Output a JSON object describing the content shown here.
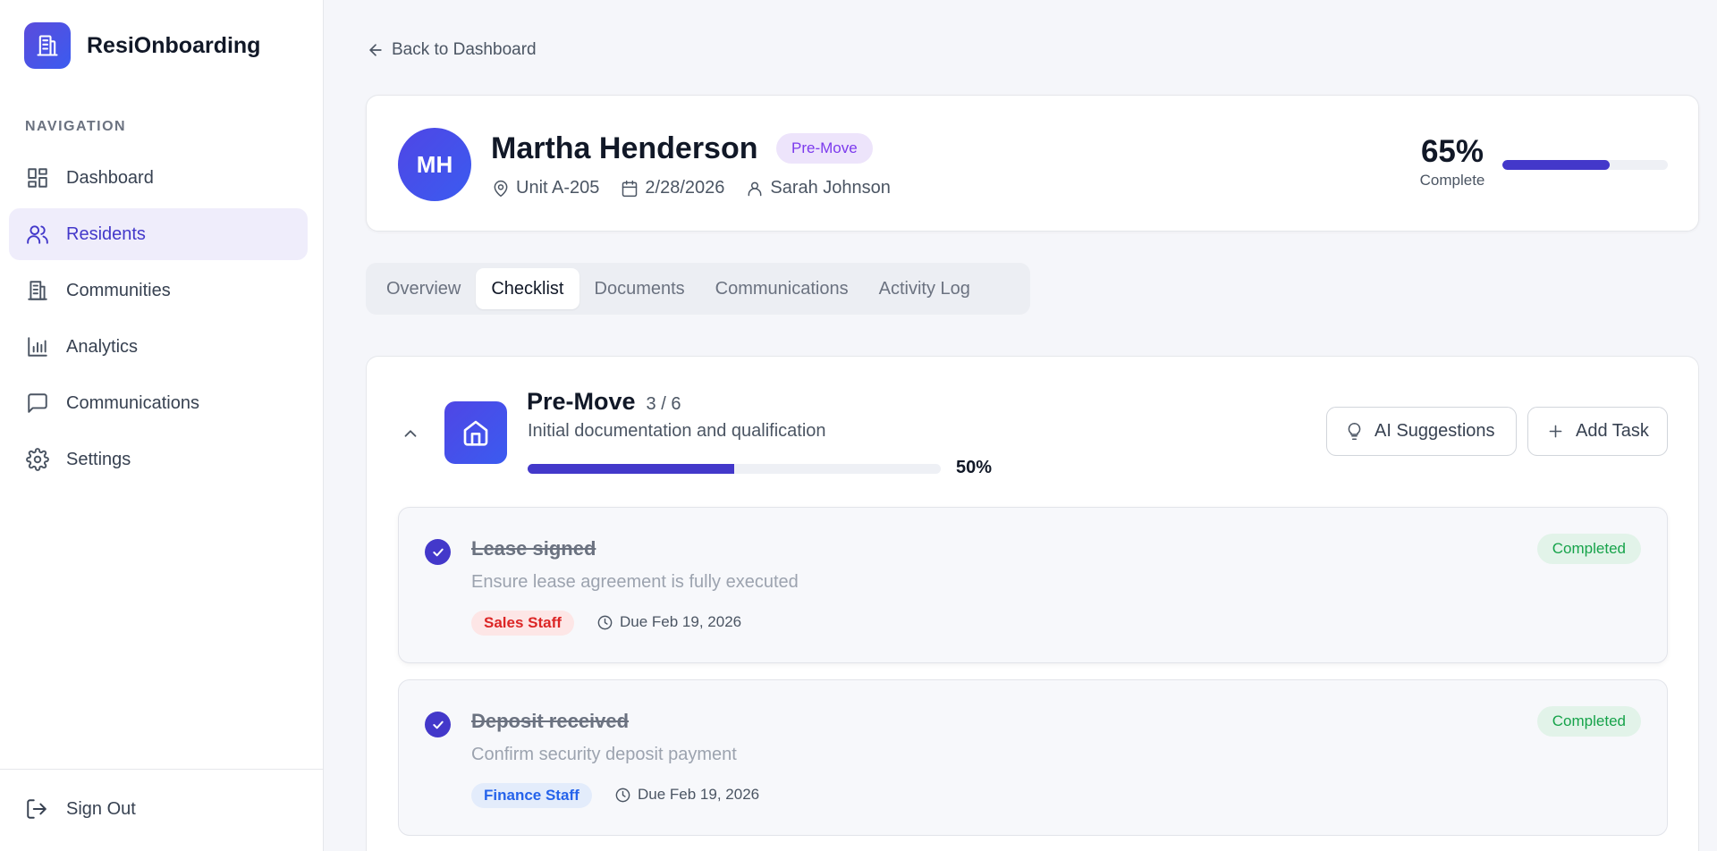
{
  "app": {
    "name": "ResiOnboarding"
  },
  "sidebar": {
    "heading": "NAVIGATION",
    "items": [
      {
        "label": "Dashboard",
        "icon": "dashboard-icon",
        "active": false
      },
      {
        "label": "Residents",
        "icon": "users-icon",
        "active": true
      },
      {
        "label": "Communities",
        "icon": "building-icon",
        "active": false
      },
      {
        "label": "Analytics",
        "icon": "bar-chart-icon",
        "active": false
      },
      {
        "label": "Communications",
        "icon": "message-icon",
        "active": false
      },
      {
        "label": "Settings",
        "icon": "gear-icon",
        "active": false
      }
    ],
    "sign_out": "Sign Out"
  },
  "back_link": "Back to Dashboard",
  "resident": {
    "initials": "MH",
    "name": "Martha Henderson",
    "stage": "Pre-Move",
    "unit": "Unit A-205",
    "date": "2/28/2026",
    "staff": "Sarah Johnson",
    "progress_text": "65%",
    "progress": 0.65,
    "progress_label": "Complete"
  },
  "tabs": [
    {
      "label": "Overview",
      "active": false
    },
    {
      "label": "Checklist",
      "active": true
    },
    {
      "label": "Documents",
      "active": false
    },
    {
      "label": "Communications",
      "active": false
    },
    {
      "label": "Activity Log",
      "active": false
    }
  ],
  "phase": {
    "title": "Pre-Move",
    "count": "3 / 6",
    "description": "Initial documentation and qualification",
    "progress_text": "50%",
    "progress": 0.5,
    "ai_button": "AI Suggestions",
    "add_button": "Add Task"
  },
  "tasks": [
    {
      "title": "Lease signed",
      "description": "Ensure lease agreement is fully executed",
      "role": "Sales Staff",
      "due": "Due Feb 19, 2026",
      "status": "Completed"
    },
    {
      "title": "Deposit received",
      "description": "Confirm security deposit payment",
      "role": "Finance Staff",
      "due": "Due Feb 19, 2026",
      "status": "Completed"
    }
  ],
  "colors": {
    "accent": "#4338ca",
    "completed": "#16a34a",
    "sales_role": "#dc2626",
    "finance_role": "#2563eb",
    "stage_badge": "#7c3aed"
  }
}
